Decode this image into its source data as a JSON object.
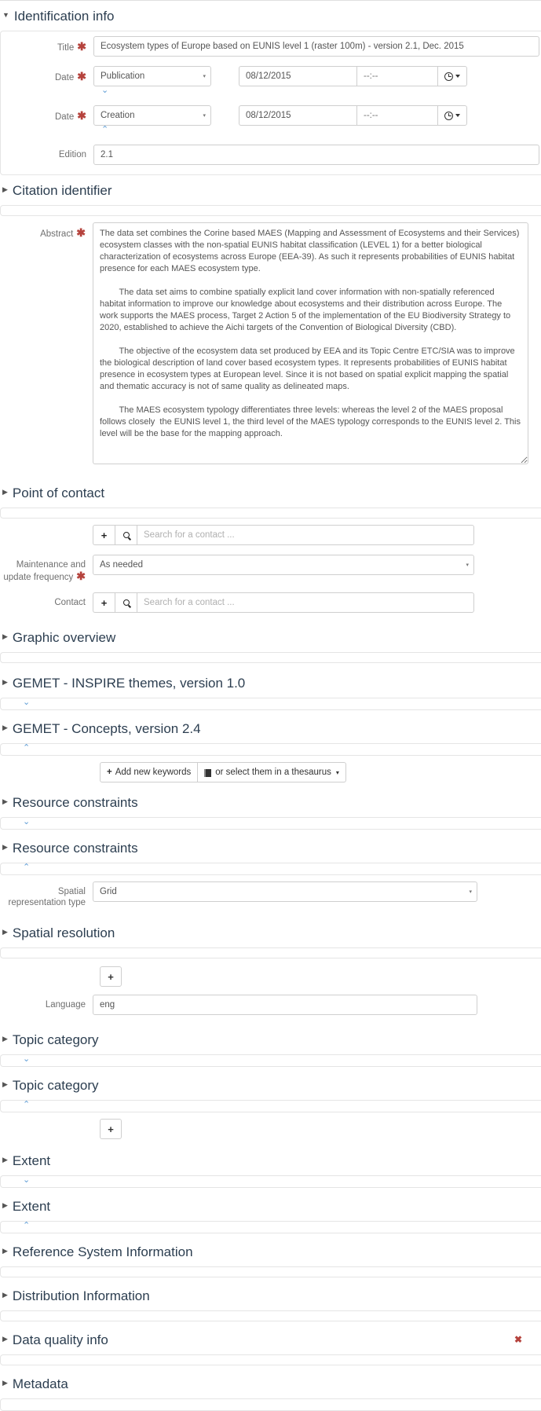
{
  "sections": {
    "identification_info": "Identification info",
    "citation_identifier": "Citation identifier",
    "point_of_contact": "Point of contact",
    "graphic_overview": "Graphic overview",
    "gemet_inspire": "GEMET - INSPIRE themes, version 1.0",
    "gemet_concepts": "GEMET - Concepts, version 2.4",
    "resource_constraints_1": "Resource constraints",
    "resource_constraints_2": "Resource constraints",
    "spatial_resolution": "Spatial resolution",
    "topic_category_1": "Topic category",
    "topic_category_2": "Topic category",
    "extent_1": "Extent",
    "extent_2": "Extent",
    "reference_system_information": "Reference System Information",
    "distribution_information": "Distribution Information",
    "data_quality_info": "Data quality info",
    "metadata": "Metadata"
  },
  "labels": {
    "title": "Title",
    "date": "Date",
    "edition": "Edition",
    "abstract": "Abstract",
    "maintenance_frequency": "Maintenance and update frequency",
    "contact": "Contact",
    "spatial_representation_type": "Spatial representation type",
    "language": "Language"
  },
  "fields": {
    "title_value": "Ecosystem types of Europe based on EUNIS level 1 (raster 100m) - version 2.1, Dec. 2015",
    "edition_value": "2.1",
    "language_value": "eng",
    "abstract_value": "The data set combines the Corine based MAES (Mapping and Assessment of Ecosystems and their Services) ecosystem classes with the non-spatial EUNIS habitat classification (LEVEL 1) for a better biological characterization of ecosystems across Europe (EEA-39). As such it represents probabilities of EUNIS habitat presence for each MAES ecosystem type.\n\n        The data set aims to combine spatially explicit land cover information with non-spatially referenced habitat information to improve our knowledge about ecosystems and their distribution across Europe. The work supports the MAES process, Target 2 Action 5 of the implementation of the EU Biodiversity Strategy to 2020, established to achieve the Aichi targets of the Convention of Biological Diversity (CBD).\n\n        The objective of the ecosystem data set produced by EEA and its Topic Centre ETC/SIA was to improve the biological description of land cover based ecosystem types. It represents probabilities of EUNIS habitat presence in ecosystem types at European level. Since it is not based on spatial explicit mapping the spatial and thematic accuracy is not of same quality as delineated maps.\n\n        The MAES ecosystem typology differentiates three levels: whereas the level 2 of the MAES proposal follows closely  the EUNIS level 1, the third level of the MAES typology corresponds to the EUNIS level 2. This level will be the base for the mapping approach."
  },
  "dates": [
    {
      "type_value": "Publication",
      "date_value": "08/12/2015",
      "time_placeholder": "--:--",
      "reorder": "down"
    },
    {
      "type_value": "Creation",
      "date_value": "08/12/2015",
      "time_placeholder": "--:--",
      "reorder": "up"
    }
  ],
  "selects": {
    "maintenance_frequency_value": "As needed",
    "spatial_representation_type_value": "Grid"
  },
  "placeholders": {
    "contact_search": "Search for a contact ..."
  },
  "buttons": {
    "add": "+",
    "add_new_keywords": "Add new keywords",
    "select_thesaurus": "or select them in a thesaurus"
  },
  "icons": {
    "required_asterisk": "✱",
    "delete_x": "✖",
    "caret_collapsed": "▶",
    "caret_expanded": "▼",
    "chevron_down": "⌄",
    "chevron_up": "⌃",
    "dropdown_caret": "▾"
  },
  "colors": {
    "header_text": "#2c3e50",
    "required": "#b5423c",
    "chevron_blue": "#5b9bd5",
    "border": "#cfcfcf",
    "panel_border": "#e5e5e5",
    "label_text": "#6f6f6f",
    "placeholder": "#b0b0b0"
  }
}
